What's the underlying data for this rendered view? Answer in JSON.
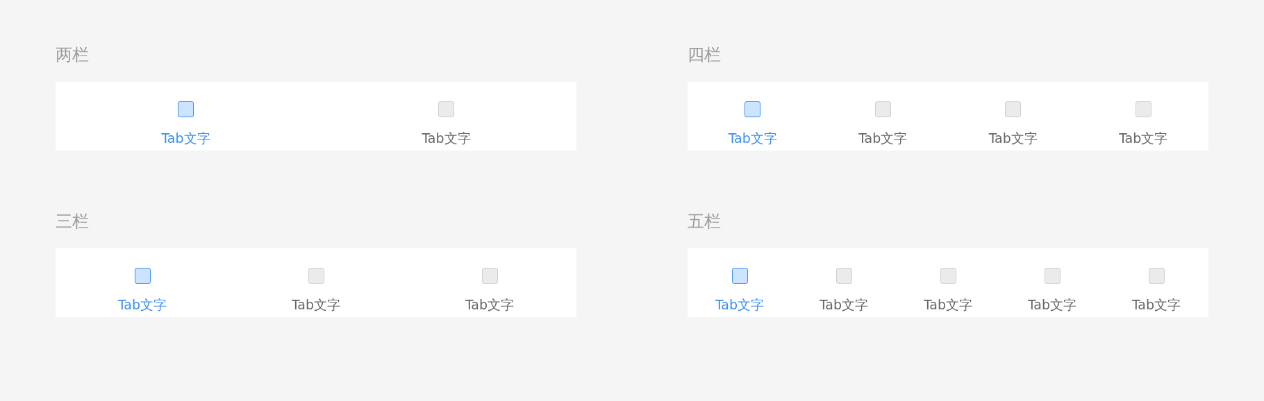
{
  "groups": [
    {
      "title": "两栏",
      "tabs": [
        {
          "label": "Tab文字",
          "selected": true
        },
        {
          "label": "Tab文字",
          "selected": false
        }
      ]
    },
    {
      "title": "四栏",
      "tabs": [
        {
          "label": "Tab文字",
          "selected": true
        },
        {
          "label": "Tab文字",
          "selected": false
        },
        {
          "label": "Tab文字",
          "selected": false
        },
        {
          "label": "Tab文字",
          "selected": false
        }
      ]
    },
    {
      "title": "三栏",
      "tabs": [
        {
          "label": "Tab文字",
          "selected": true
        },
        {
          "label": "Tab文字",
          "selected": false
        },
        {
          "label": "Tab文字",
          "selected": false
        }
      ]
    },
    {
      "title": "五栏",
      "tabs": [
        {
          "label": "Tab文字",
          "selected": true
        },
        {
          "label": "Tab文字",
          "selected": false
        },
        {
          "label": "Tab文字",
          "selected": false
        },
        {
          "label": "Tab文字",
          "selected": false
        },
        {
          "label": "Tab文字",
          "selected": false
        }
      ]
    }
  ]
}
